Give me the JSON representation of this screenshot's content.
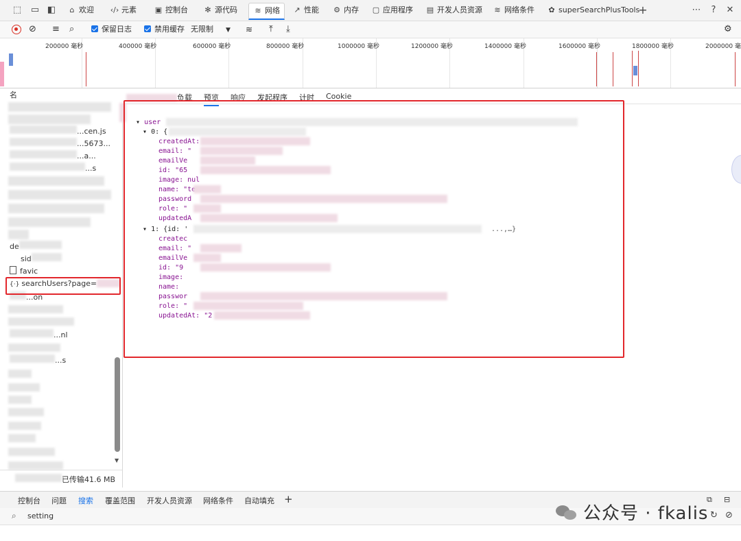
{
  "browser_tabs": [
    {
      "label": "欢迎",
      "icon": "home-icon"
    },
    {
      "label": "元素",
      "icon": "code-icon"
    },
    {
      "label": "控制台",
      "icon": "console-icon"
    },
    {
      "label": "源代码",
      "icon": "bug-icon"
    },
    {
      "label": "网络",
      "icon": "wifi-icon",
      "active": true
    },
    {
      "label": "性能",
      "icon": "gauge-icon"
    },
    {
      "label": "内存",
      "icon": "gear-icon"
    },
    {
      "label": "应用程序",
      "icon": "window-icon"
    },
    {
      "label": "开发人员资源",
      "icon": "doc-icon"
    },
    {
      "label": "网络条件",
      "icon": "network-conditions-icon"
    },
    {
      "label": "superSearchPlusTools",
      "icon": "extension-icon"
    }
  ],
  "toolbar": {
    "preserve_log": "保留日志",
    "disable_cache": "禁用缓存",
    "throttle": "无限制"
  },
  "overview": {
    "ticks": [
      "200000 毫秒",
      "400000 毫秒",
      "600000 毫秒",
      "800000 毫秒",
      "1000000 毫秒",
      "1200000 毫秒",
      "1400000 毫秒",
      "1600000 毫秒",
      "1800000 毫秒",
      "2000000 毫秒"
    ]
  },
  "request_list": {
    "header": "名",
    "rows": [
      {
        "text": "...cen.js"
      },
      {
        "text": "...5673..."
      },
      {
        "text": "...a..."
      },
      {
        "text": "...s"
      },
      {
        "text": "de"
      },
      {
        "text": "sid"
      },
      {
        "text": "favic"
      },
      {
        "text": "searchUsers?page=",
        "selected": true
      },
      {
        "text": "...on"
      },
      {
        "text": "...nl"
      },
      {
        "text": "...s"
      }
    ],
    "status": "已传输41.6 MB"
  },
  "details": {
    "tabs": [
      "负载",
      "预览",
      "响应",
      "发起程序",
      "计时",
      "Cookie"
    ],
    "active_tab": "预览"
  },
  "preview": {
    "root_key": "user",
    "item0_header": "0: {",
    "item0_fields": [
      "createdAt:",
      "email: \"",
      "emailVe",
      "id: \"65",
      "image: nul",
      "name: \"te",
      "password",
      "role: \"",
      "updatedA"
    ],
    "item1_header": "1: {id: '",
    "item1_tail": "...,…}",
    "item1_fields": [
      "createc",
      "email: \"",
      "emailVe",
      "id: \"9",
      "image:",
      "name:",
      "passwor",
      "role: \"",
      "updatedAt: \"2"
    ]
  },
  "drawer": {
    "tabs": [
      "控制台",
      "问题",
      "搜索",
      "覆盖范围",
      "开发人员资源",
      "网络条件",
      "自动填充"
    ],
    "active_tab": "搜索",
    "search_value": "setting"
  },
  "watermark": "公众号 · fkalis"
}
